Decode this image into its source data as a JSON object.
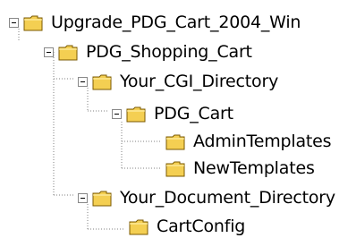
{
  "tree": {
    "nodes": [
      {
        "label": "Upgrade_PDG_Cart_2004_Win",
        "expanded": true,
        "icon": "folder-icon"
      },
      {
        "label": "PDG_Shopping_Cart",
        "expanded": true,
        "icon": "folder-icon"
      },
      {
        "label": "Your_CGI_Directory",
        "expanded": true,
        "icon": "folder-icon"
      },
      {
        "label": "PDG_Cart",
        "expanded": true,
        "icon": "folder-icon"
      },
      {
        "label": "AdminTemplates",
        "expanded": false,
        "icon": "folder-icon"
      },
      {
        "label": "NewTemplates",
        "expanded": false,
        "icon": "folder-icon"
      },
      {
        "label": "Your_Document_Directory",
        "expanded": true,
        "icon": "folder-icon"
      },
      {
        "label": "CartConfig",
        "expanded": false,
        "icon": "folder-icon"
      }
    ]
  },
  "colors": {
    "folder_fill": "#f4cf52",
    "folder_outline": "#7b5a00",
    "connector": "#808080"
  }
}
